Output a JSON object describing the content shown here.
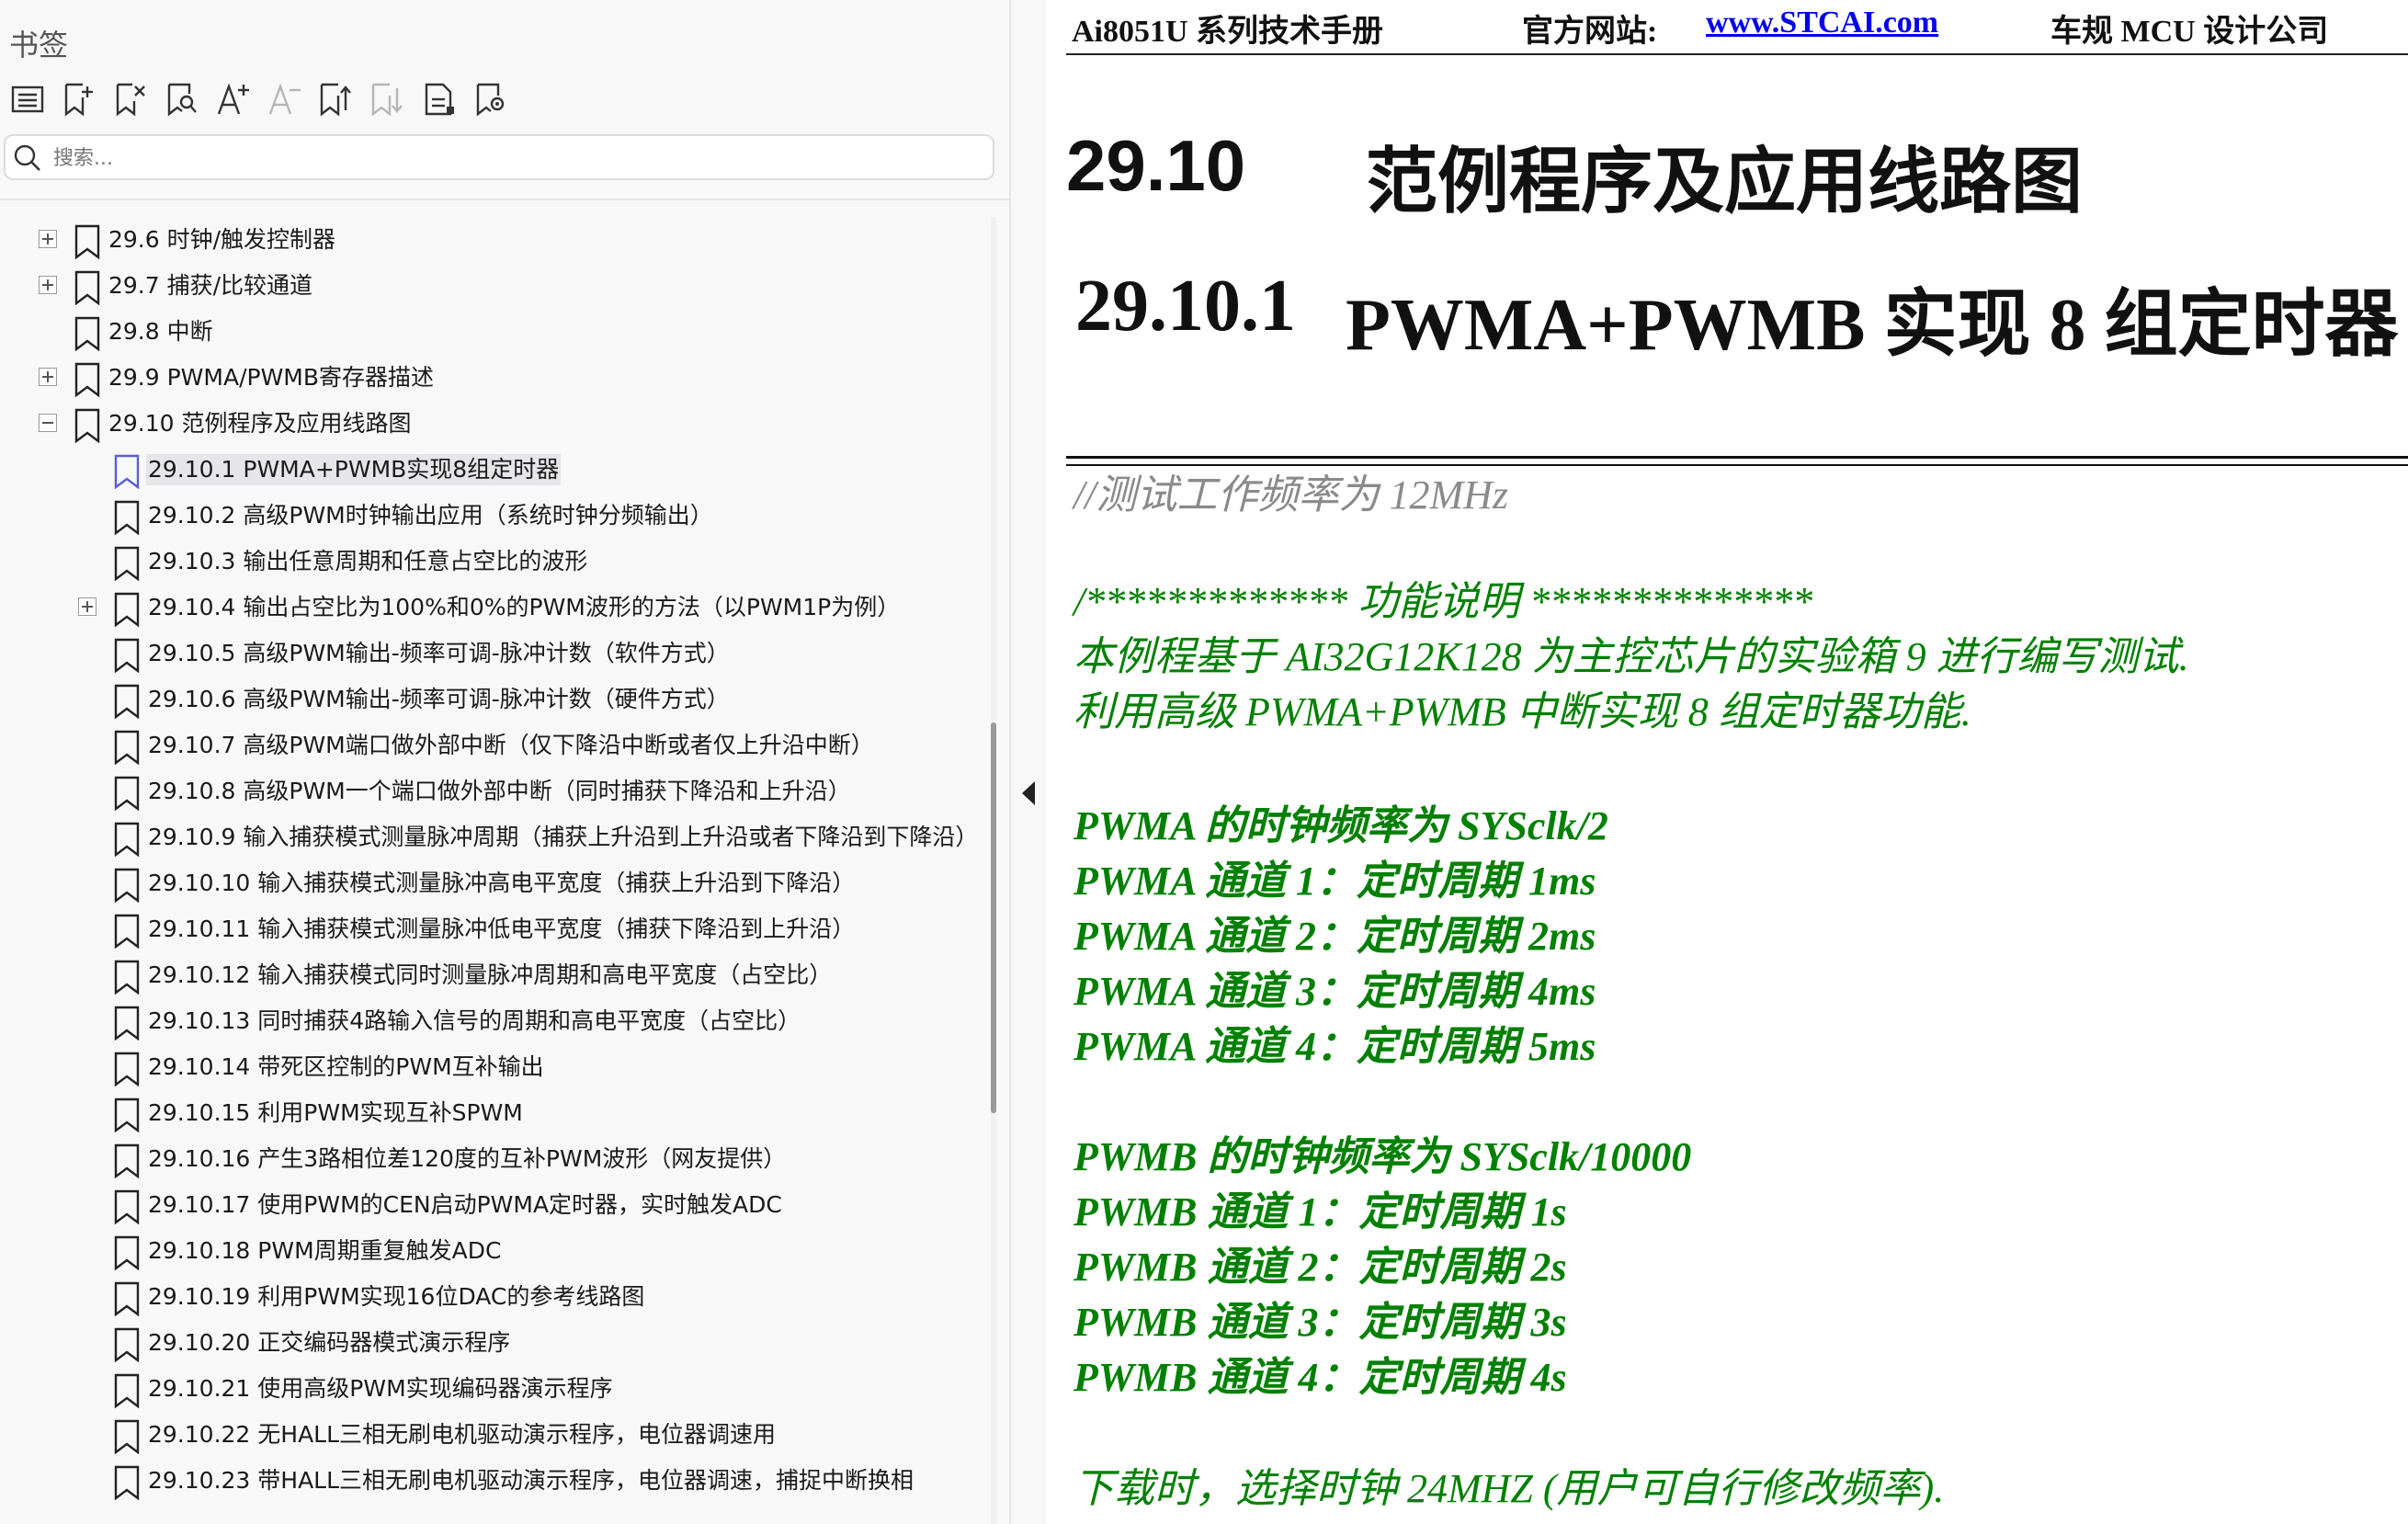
{
  "panel": {
    "title": "书签",
    "toolbar": [
      {
        "name": "bookmark-list-icon"
      },
      {
        "name": "add-bookmark-icon"
      },
      {
        "name": "delete-bookmark-icon"
      },
      {
        "name": "find-bookmark-icon"
      },
      {
        "name": "increase-font-icon"
      },
      {
        "name": "decrease-font-icon"
      },
      {
        "name": "expand-bookmarks-icon"
      },
      {
        "name": "collapse-bookmarks-icon"
      },
      {
        "name": "bookmark-properties-icon"
      },
      {
        "name": "bookmark-location-icon"
      }
    ],
    "search_placeholder": "搜索..."
  },
  "tree": [
    {
      "label": "29.6  时钟/触发控制器",
      "level": 1,
      "expander": "plus",
      "selected": false
    },
    {
      "label": "29.7 捕获/比较通道",
      "level": 1,
      "expander": "plus",
      "selected": false
    },
    {
      "label": "29.8 中断",
      "level": 1,
      "expander": "none",
      "selected": false
    },
    {
      "label": "29.9  PWMA/PWMB寄存器描述",
      "level": 1,
      "expander": "plus",
      "selected": false
    },
    {
      "label": "29.10  范例程序及应用线路图",
      "level": 1,
      "expander": "minus",
      "selected": false
    },
    {
      "label": "29.10.1 PWMA+PWMB实现8组定时器",
      "level": 2,
      "expander": "none",
      "selected": true
    },
    {
      "label": "29.10.2 高级PWM时钟输出应用（系统时钟分频输出）",
      "level": 2,
      "expander": "none",
      "selected": false
    },
    {
      "label": "29.10.3 输出任意周期和任意占空比的波形",
      "level": 2,
      "expander": "none",
      "selected": false
    },
    {
      "label": "29.10.4  输出占空比为100%和0%的PWM波形的方法（以PWM1P为例）",
      "level": 2,
      "expander": "plus",
      "selected": false
    },
    {
      "label": "29.10.5 高级PWM输出-频率可调-脉冲计数（软件方式）",
      "level": 2,
      "expander": "none",
      "selected": false
    },
    {
      "label": "29.10.6 高级PWM输出-频率可调-脉冲计数（硬件方式）",
      "level": 2,
      "expander": "none",
      "selected": false
    },
    {
      "label": "29.10.7 高级PWM端口做外部中断（仅下降沿中断或者仅上升沿中断）",
      "level": 2,
      "expander": "none",
      "selected": false
    },
    {
      "label": "29.10.8 高级PWM一个端口做外部中断（同时捕获下降沿和上升沿）",
      "level": 2,
      "expander": "none",
      "selected": false
    },
    {
      "label": "29.10.9 输入捕获模式测量脉冲周期（捕获上升沿到上升沿或者下降沿到下降沿）",
      "level": 2,
      "expander": "none",
      "selected": false
    },
    {
      "label": "29.10.10  输入捕获模式测量脉冲高电平宽度（捕获上升沿到下降沿）",
      "level": 2,
      "expander": "none",
      "selected": false
    },
    {
      "label": "29.10.11  输入捕获模式测量脉冲低电平宽度（捕获下降沿到上升沿）",
      "level": 2,
      "expander": "none",
      "selected": false
    },
    {
      "label": "29.10.12  输入捕获模式同时测量脉冲周期和高电平宽度（占空比）",
      "level": 2,
      "expander": "none",
      "selected": false
    },
    {
      "label": "29.10.13  同时捕获4路输入信号的周期和高电平宽度（占空比）",
      "level": 2,
      "expander": "none",
      "selected": false
    },
    {
      "label": "29.10.14 带死区控制的PWM互补输出",
      "level": 2,
      "expander": "none",
      "selected": false
    },
    {
      "label": "29.10.15 利用PWM实现互补SPWM",
      "level": 2,
      "expander": "none",
      "selected": false
    },
    {
      "label": "29.10.16  产生3路相位差120度的互补PWM波形（网友提供）",
      "level": 2,
      "expander": "none",
      "selected": false
    },
    {
      "label": "29.10.17 使用PWM的CEN启动PWMA定时器，实时触发ADC",
      "level": 2,
      "expander": "none",
      "selected": false
    },
    {
      "label": "29.10.18 PWM周期重复触发ADC",
      "level": 2,
      "expander": "none",
      "selected": false
    },
    {
      "label": "29.10.19 利用PWM实现16位DAC的参考线路图",
      "level": 2,
      "expander": "none",
      "selected": false
    },
    {
      "label": "29.10.20 正交编码器模式演示程序",
      "level": 2,
      "expander": "none",
      "selected": false
    },
    {
      "label": "29.10.21 使用高级PWM实现编码器演示程序",
      "level": 2,
      "expander": "none",
      "selected": false
    },
    {
      "label": "29.10.22 无HALL三相无刷电机驱动演示程序，电位器调速用",
      "level": 2,
      "expander": "none",
      "selected": false
    },
    {
      "label": "29.10.23 带HALL三相无刷电机驱动演示程序，电位器调速，捕捉中断换相",
      "level": 2,
      "expander": "none",
      "selected": false
    }
  ],
  "doc": {
    "header": {
      "left": "Ai8051U 系列技术手册",
      "site_label": "官方网站: ",
      "site_link": "www.STCAI.com",
      "right": "车规 MCU 设计公司"
    },
    "section_number": "29.10",
    "section_title": "范例程序及应用线路图",
    "subsection_number": "29.10.1",
    "subsection_title": "PWMA+PWMB 实现 8 组定时器",
    "code_lines": [
      {
        "text": "//测试工作频率为 12MHz",
        "style": "gray"
      },
      {
        "text": "",
        "style": "green"
      },
      {
        "text": "/*************  功能说明  **************",
        "style": "green"
      },
      {
        "text": "本例程基于 AI32G12K128 为主控芯片的实验箱 9 进行编写测试.",
        "style": "green"
      },
      {
        "text": "利用高级 PWMA+PWMB 中断实现 8 组定时器功能.",
        "style": "green"
      },
      {
        "text": "",
        "style": "green"
      },
      {
        "text": "PWMA 的时钟频率为  SYSclk/2",
        "style": "green-bold"
      },
      {
        "text": "PWMA 通道 1：定时周期  1ms",
        "style": "green-bold"
      },
      {
        "text": "PWMA 通道 2：定时周期  2ms",
        "style": "green-bold"
      },
      {
        "text": "PWMA 通道 3：定时周期  4ms",
        "style": "green-bold"
      },
      {
        "text": "PWMA 通道 4：定时周期  5ms",
        "style": "green-bold"
      },
      {
        "text": "",
        "style": "green"
      },
      {
        "text": "PWMB 的时钟频率为  SYSclk/10000",
        "style": "green-bold"
      },
      {
        "text": "PWMB 通道 1：定时周期  1s",
        "style": "green-bold"
      },
      {
        "text": "PWMB 通道 2：定时周期  2s",
        "style": "green-bold"
      },
      {
        "text": "PWMB 通道 3：定时周期  3s",
        "style": "green-bold"
      },
      {
        "text": "PWMB 通道 4：定时周期  4s",
        "style": "green-bold"
      },
      {
        "text": "",
        "style": "green"
      },
      {
        "text": "下载时，选择时钟  24MHZ (用户可自行修改频率).",
        "style": "green"
      }
    ]
  },
  "colors": {
    "code_green": "#008000",
    "code_gray": "#8a8a8a",
    "link_blue": "#0000ee",
    "selected_bookmark": "#5a5fd0"
  }
}
